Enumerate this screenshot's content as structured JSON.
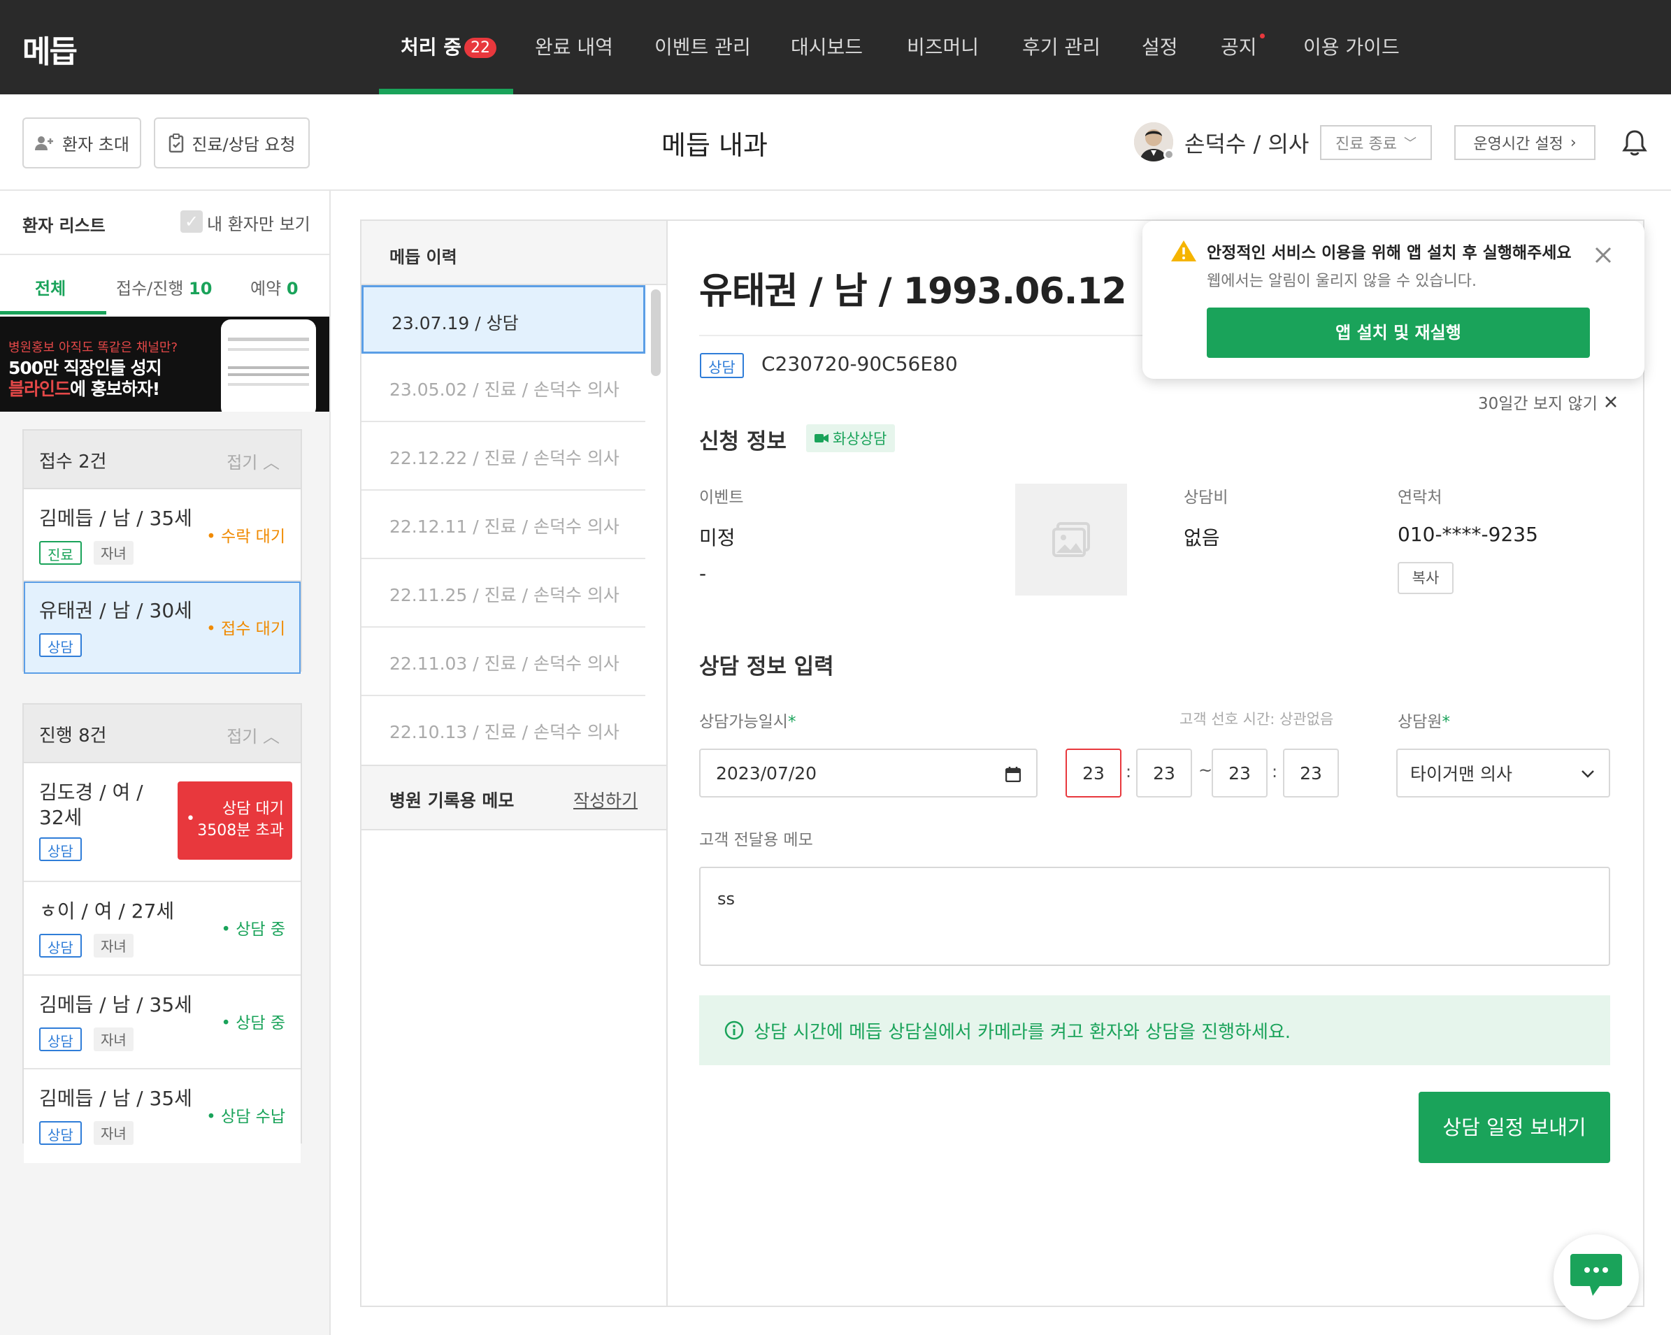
{
  "nav": {
    "logo": "메듭",
    "items": [
      "처리 중",
      "완료 내역",
      "이벤트 관리",
      "대시보드",
      "비즈머니",
      "후기 관리",
      "설정",
      "공지",
      "이용 가이드"
    ],
    "processing_count": "22"
  },
  "header": {
    "invite_label": "환자 초대",
    "request_label": "진료/상담 요청",
    "hospital": "메듭 내과",
    "doctor": "손덕수 / 의사",
    "end_label": "진료 종료",
    "hours_label": "운영시간 설정"
  },
  "sidebar": {
    "title": "환자 리스트",
    "mine_only": "내 환자만 보기",
    "tabs": {
      "all": "전체",
      "progress_label": "접수/진행",
      "progress_count": "10",
      "reserve_label": "예약",
      "reserve_count": "0"
    },
    "banner": {
      "line1": "병원홍보 아직도 똑같은 채널만?",
      "line2": "500만 직장인들 성지",
      "line3a": "블라인드",
      "line3b": "에 홍보하자!"
    },
    "reception": {
      "title": "접수 2건",
      "fold": "접기",
      "cards": [
        {
          "name": "김메듭 / 남 / 35세",
          "tag": "진료",
          "tag2": "자녀",
          "status": "수락 대기"
        },
        {
          "name": "유태권 / 남 / 30세",
          "tag": "상담",
          "status": "접수 대기"
        }
      ]
    },
    "progress": {
      "title": "진행 8건",
      "fold": "접기",
      "cards": [
        {
          "name1": "김도경 / 여 /",
          "name2": "32세",
          "tag": "상담",
          "status1": "상담 대기",
          "status2": "3508분 초과"
        },
        {
          "name": "ㅎ이 / 여 / 27세",
          "tag": "상담",
          "tag2": "자녀",
          "status": "상담 중"
        },
        {
          "name": "김메듭 / 남 / 35세",
          "tag": "상담",
          "tag2": "자녀",
          "status": "상담 중"
        },
        {
          "name": "김메듭 / 남 / 35세",
          "tag": "상담",
          "tag2": "자녀",
          "status": "상담 수납"
        }
      ]
    }
  },
  "history": {
    "title": "메듭 이력",
    "items": [
      "23.07.19 / 상담",
      "23.05.02 / 진료 / 손덕수 의사",
      "22.12.22 / 진료 / 손덕수 의사",
      "22.12.11 / 진료 / 손덕수 의사",
      "22.11.25 / 진료 / 손덕수 의사",
      "22.11.03 / 진료 / 손덕수 의사",
      "22.10.13 / 진료 / 손덕수 의사"
    ],
    "memo_title": "병원 기록용 메모",
    "memo_write": "작성하기"
  },
  "detail": {
    "patient": "유태권 / 남 / 1993.06.12",
    "type_tag": "상담",
    "code": "C230720-90C56E80",
    "apply_title": "신청 정보",
    "video_tag": "화상상담",
    "event_label": "이벤트",
    "event_value": "미정",
    "event_sub": "-",
    "fee_label": "상담비",
    "fee_value": "없음",
    "contact_label": "연락처",
    "contact_value": "010-****-9235",
    "copy_label": "복사",
    "input_title": "상담 정보 입력",
    "datetime_label": "상담가능일시",
    "pref_time": "고객 선호 시간: 상관없음",
    "counselor_label": "상담원",
    "date_value": "2023/07/20",
    "h1": "23",
    "m1": "23",
    "h2": "23",
    "m2": "23",
    "counselor_value": "타이거맨 의사",
    "memo_label": "고객 전달용 메모",
    "memo_value": "ss",
    "info_text": "상담 시간에 메듭 상담실에서 카메라를 켜고 환자와 상담을 진행하세요.",
    "send_label": "상담 일정 보내기"
  },
  "popup": {
    "title": "안정적인 서비스 이용을 위해 앱 설치 후 실행해주세요",
    "sub": "웹에서는 알림이 울리지 않을 수 있습니다.",
    "button": "앱 설치 및 재실행",
    "dismiss": "30일간 보지 않기"
  },
  "colors": {
    "green": "#1aa35a",
    "blue": "#2f7dd8",
    "orange": "#f08a00",
    "red": "#e8383d",
    "nav_bg": "#2a2a2a"
  }
}
